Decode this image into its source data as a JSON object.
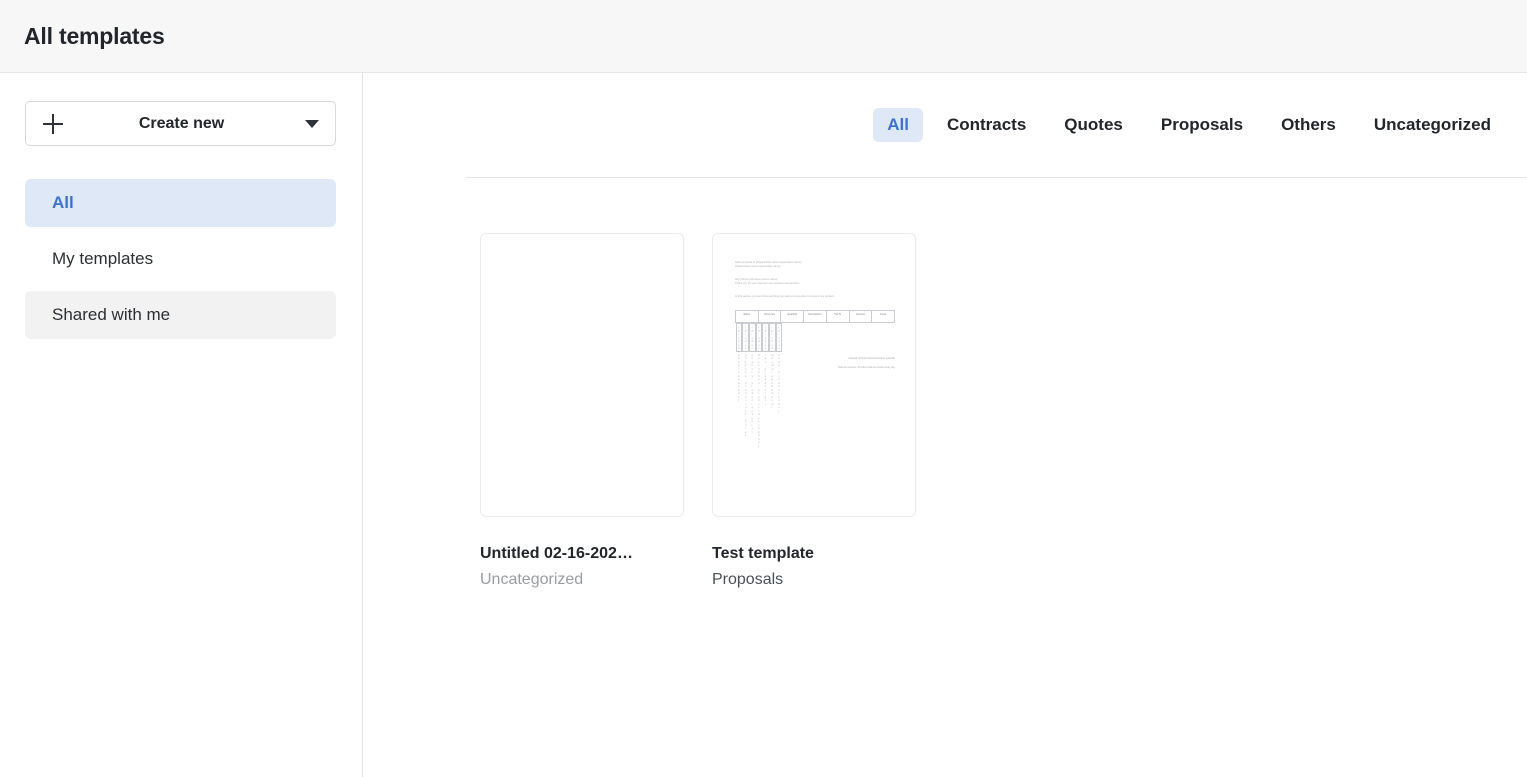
{
  "header": {
    "title": "All templates"
  },
  "sidebar": {
    "create_button": {
      "label": "Create new",
      "plus_icon": "plus-icon",
      "caret_icon": "chevron-down-icon"
    },
    "items": [
      {
        "label": "All",
        "state": "active"
      },
      {
        "label": "My templates",
        "state": "default"
      },
      {
        "label": "Shared with me",
        "state": "hovered"
      }
    ]
  },
  "main": {
    "tabs": [
      {
        "label": "All",
        "active": true
      },
      {
        "label": "Contracts",
        "active": false
      },
      {
        "label": "Quotes",
        "active": false
      },
      {
        "label": "Proposals",
        "active": false
      },
      {
        "label": "Others",
        "active": false
      },
      {
        "label": "Uncategorized",
        "active": false
      }
    ],
    "cards": [
      {
        "title": "Untitled 02-16-202…",
        "category": "Uncategorized",
        "category_muted": true,
        "preview": "blank"
      },
      {
        "title": "Test template",
        "category": "Proposals",
        "category_muted": false,
        "preview": "proposal-document"
      }
    ]
  },
  "preview_document": {
    "heading_lines": [
      "Sales proposal to {Organization name:organization name}",
      "{Organization name:organization name}"
    ],
    "greeting_lines": [
      "Hey {Person full name:person name},",
      "Thank you for your interest in our products and services."
    ],
    "intro_lines": [
      "In this section, you can find everything you want to know when it comes to our product."
    ],
    "table": {
      "columns": [
        "Name",
        "Unit price",
        "Quantity",
        "Description",
        "Tax %",
        "Amount",
        "Code"
      ],
      "rows": [
        [
          "{Product name:product name}",
          "{Product unit price:product unit_price}",
          "{Product quantity:product quantity}",
          "{Product description:product description}",
          "{Product tax:product tax}",
          "{Product amount:product amount}",
          "{Product code:product code}"
        ]
      ]
    },
    "totals": [
      "Subtotal: {Product subtotal:product subtotal}",
      "Total tax inclusive: {Product total tax:product total_tax}"
    ]
  },
  "colors": {
    "accent_blue": "#3c72d7",
    "accent_blue_bg": "#dfe8f7",
    "header_bg": "#f7f7f7",
    "hover_gray": "#f2f2f2",
    "text_dark": "#22262b",
    "text_muted": "#9a9da1"
  }
}
